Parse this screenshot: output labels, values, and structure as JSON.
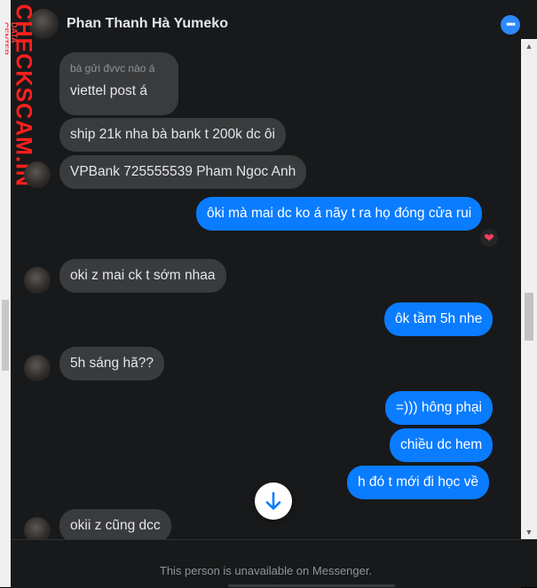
{
  "header": {
    "name": "Phan Thanh Hà Yumeko",
    "more_icon": "more-options-icon"
  },
  "watermark": {
    "site": "CHECKSCAM.INFO",
    "tag": "DATA CENTER"
  },
  "messages": [
    {
      "reply_preview": "bà gửi đvvc nào á",
      "text": "viettel post á",
      "side": "in"
    },
    {
      "text": "ship 21k nha bà bank t 200k dc ôi",
      "side": "in"
    },
    {
      "text": "VPBank 725555539 Pham Ngoc Anh",
      "side": "in"
    },
    {
      "text": "ôki mà mai dc ko á nãy t ra họ đóng cửa rui",
      "side": "out",
      "reaction": "❤"
    },
    {
      "text": "oki z mai ck t sớm nhaa",
      "side": "in"
    },
    {
      "text": "ôk tầm 5h nhe",
      "side": "out"
    },
    {
      "text": "5h sáng hã??",
      "side": "in"
    },
    {
      "text": "=))) hông phại",
      "side": "out"
    },
    {
      "text": "chiều dc hem",
      "side": "out"
    },
    {
      "text": "h đó t mới đi học về",
      "side": "out"
    },
    {
      "text": "okii z cũng dcc",
      "side": "in"
    }
  ],
  "footer": {
    "text": "This person is unavailable on Messenger."
  },
  "colors": {
    "background": "#18191a",
    "incoming": "#3a3b3c",
    "outgoing": "#0a7cff",
    "accent": "#2e89ff"
  }
}
